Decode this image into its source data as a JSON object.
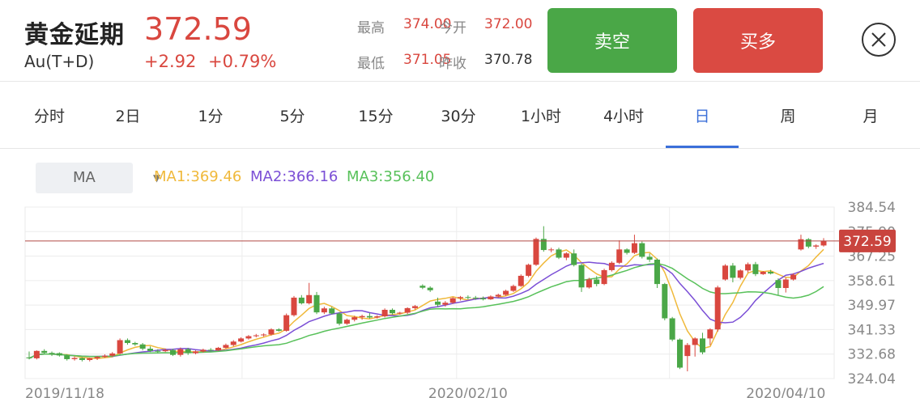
{
  "instrument": {
    "name": "黄金延期",
    "code": "Au(T+D)",
    "price": "372.59",
    "change": "+2.92",
    "change_pct": "+0.79%"
  },
  "quote": {
    "high_label": "最高",
    "high_value": "374.00",
    "open_label": "今开",
    "open_value": "372.00",
    "low_label": "最低",
    "low_value": "371.05",
    "prev_close_label": "昨收",
    "prev_close_value": "370.78"
  },
  "actions": {
    "sell_label": "卖空",
    "buy_label": "买多",
    "close_icon": "close-circle-icon"
  },
  "tabs": [
    {
      "label": "分时"
    },
    {
      "label": "2日"
    },
    {
      "label": "1分"
    },
    {
      "label": "5分"
    },
    {
      "label": "15分"
    },
    {
      "label": "30分"
    },
    {
      "label": "1小时"
    },
    {
      "label": "4小时"
    },
    {
      "label": "日",
      "active": true
    },
    {
      "label": "周"
    },
    {
      "label": "月"
    }
  ],
  "indicator": {
    "selected": "MA",
    "ma1": "MA1:369.46",
    "ma2": "MA2:366.16",
    "ma3": "MA3:356.40"
  },
  "colors": {
    "up": "#d9473f",
    "down": "#4aa747",
    "ma1": "#f0b93b",
    "ma2": "#7b4fd6",
    "ma3": "#58c15a",
    "active_tab": "#3b6fd9"
  },
  "chart_data": {
    "type": "candlestick",
    "y_ticks": [
      "384.54",
      "375.90",
      "367.25",
      "358.61",
      "349.97",
      "341.33",
      "332.68",
      "324.04"
    ],
    "ylim": [
      324.04,
      384.54
    ],
    "x_tick_labels": [
      {
        "label": "2019/11/18",
        "index": 0
      },
      {
        "label": "2020/02/10",
        "index": 58
      },
      {
        "label": "2020/04/10",
        "index": 100
      }
    ],
    "last_price_label": "372.59",
    "last_price": 372.59,
    "candles": [
      [
        331.5,
        333.6,
        330.8,
        331.2
      ],
      [
        331.2,
        334.0,
        330.8,
        333.8
      ],
      [
        333.8,
        334.4,
        332.6,
        333.1
      ],
      [
        333.1,
        333.6,
        332.0,
        332.5
      ],
      [
        333.0,
        333.3,
        331.8,
        332.2
      ],
      [
        332.2,
        332.6,
        330.4,
        330.9
      ],
      [
        330.9,
        331.8,
        330.4,
        331.3
      ],
      [
        331.3,
        331.6,
        330.1,
        330.6
      ],
      [
        330.6,
        331.4,
        330.1,
        331.2
      ],
      [
        331.2,
        332.0,
        330.6,
        331.7
      ],
      [
        331.7,
        332.6,
        331.4,
        332.1
      ],
      [
        332.1,
        333.4,
        331.8,
        332.9
      ],
      [
        332.9,
        338.2,
        332.6,
        337.6
      ],
      [
        337.6,
        338.2,
        336.0,
        336.6
      ],
      [
        336.6,
        337.0,
        335.6,
        336.1
      ],
      [
        336.1,
        336.6,
        334.0,
        334.6
      ],
      [
        334.6,
        335.4,
        333.4,
        333.8
      ],
      [
        333.8,
        334.4,
        333.0,
        333.7
      ],
      [
        333.7,
        334.6,
        333.4,
        334.1
      ],
      [
        334.1,
        334.6,
        332.0,
        332.4
      ],
      [
        332.4,
        335.0,
        331.8,
        334.4
      ],
      [
        334.4,
        334.9,
        332.4,
        333.0
      ],
      [
        333.0,
        334.0,
        332.6,
        333.6
      ],
      [
        333.6,
        334.6,
        333.2,
        334.2
      ],
      [
        334.2,
        334.8,
        333.6,
        334.0
      ],
      [
        334.0,
        335.2,
        333.8,
        334.9
      ],
      [
        334.9,
        336.4,
        334.6,
        335.9
      ],
      [
        335.9,
        337.6,
        335.4,
        337.1
      ],
      [
        337.1,
        338.6,
        336.8,
        338.2
      ],
      [
        338.2,
        339.4,
        337.8,
        339.0
      ],
      [
        339.0,
        339.8,
        338.6,
        339.3
      ],
      [
        339.3,
        340.0,
        338.8,
        339.6
      ],
      [
        339.6,
        341.8,
        339.2,
        341.4
      ],
      [
        341.4,
        341.8,
        340.6,
        340.9
      ],
      [
        340.9,
        347.0,
        340.6,
        346.4
      ],
      [
        346.4,
        353.2,
        345.9,
        352.6
      ],
      [
        352.6,
        353.5,
        350.2,
        350.6
      ],
      [
        350.6,
        357.8,
        350.2,
        353.5
      ],
      [
        353.5,
        354.6,
        346.8,
        347.4
      ],
      [
        347.4,
        349.4,
        346.8,
        348.8
      ],
      [
        348.8,
        349.4,
        346.6,
        347.0
      ],
      [
        347.0,
        347.5,
        342.8,
        343.4
      ],
      [
        343.4,
        345.2,
        343.0,
        344.8
      ],
      [
        344.8,
        346.2,
        344.2,
        345.7
      ],
      [
        345.7,
        346.6,
        344.8,
        346.1
      ],
      [
        346.1,
        347.2,
        345.2,
        345.6
      ],
      [
        345.6,
        346.4,
        345.2,
        346.0
      ],
      [
        346.0,
        348.8,
        345.6,
        348.3
      ],
      [
        348.3,
        348.8,
        346.6,
        347.1
      ],
      [
        347.1,
        347.6,
        346.6,
        347.3
      ],
      [
        347.3,
        349.2,
        346.8,
        348.9
      ],
      [
        348.9,
        350.0,
        348.4,
        349.6
      ],
      [
        356.8,
        357.3,
        355.6,
        356.1
      ],
      [
        356.1,
        356.6,
        354.6,
        355.2
      ],
      [
        351.2,
        352.6,
        349.4,
        350.1
      ],
      [
        350.1,
        351.4,
        349.4,
        350.8
      ],
      [
        350.8,
        352.8,
        350.4,
        352.4
      ],
      [
        352.4,
        353.2,
        351.6,
        352.8
      ],
      [
        352.8,
        353.4,
        352.0,
        352.6
      ],
      [
        352.6,
        353.2,
        351.8,
        352.4
      ],
      [
        352.4,
        353.0,
        351.6,
        352.0
      ],
      [
        352.0,
        353.4,
        351.8,
        353.0
      ],
      [
        353.0,
        354.0,
        352.6,
        353.6
      ],
      [
        353.6,
        355.4,
        353.2,
        355.0
      ],
      [
        355.0,
        357.2,
        354.6,
        356.7
      ],
      [
        356.7,
        360.8,
        356.4,
        360.3
      ],
      [
        360.3,
        364.6,
        359.8,
        364.2
      ],
      [
        364.2,
        373.8,
        363.8,
        373.3
      ],
      [
        373.3,
        377.8,
        368.8,
        369.4
      ],
      [
        369.4,
        370.2,
        368.6,
        369.6
      ],
      [
        369.6,
        370.2,
        366.2,
        366.7
      ],
      [
        366.7,
        368.6,
        365.8,
        368.2
      ],
      [
        368.2,
        369.6,
        363.6,
        364.1
      ],
      [
        364.1,
        364.6,
        354.6,
        356.2
      ],
      [
        356.2,
        359.6,
        355.8,
        359.0
      ],
      [
        359.0,
        360.2,
        356.6,
        357.4
      ],
      [
        357.4,
        362.8,
        357.0,
        362.3
      ],
      [
        362.3,
        365.4,
        361.8,
        364.9
      ],
      [
        364.9,
        372.8,
        364.4,
        369.6
      ],
      [
        369.6,
        370.0,
        367.8,
        368.4
      ],
      [
        368.4,
        374.8,
        368.0,
        371.8
      ],
      [
        371.8,
        372.4,
        366.4,
        367.0
      ],
      [
        367.0,
        368.2,
        365.2,
        366.0
      ],
      [
        366.0,
        366.4,
        356.0,
        357.4
      ],
      [
        357.4,
        357.8,
        344.6,
        345.3
      ],
      [
        345.3,
        345.8,
        337.2,
        337.8
      ],
      [
        337.8,
        338.2,
        327.4,
        327.9
      ],
      [
        332.0,
        336.6,
        326.6,
        335.9
      ],
      [
        335.9,
        338.6,
        331.8,
        338.2
      ],
      [
        338.2,
        340.2,
        332.6,
        333.3
      ],
      [
        338.2,
        341.8,
        335.8,
        341.4
      ],
      [
        341.4,
        356.8,
        340.6,
        356.2
      ],
      [
        359.0,
        364.4,
        358.6,
        363.9
      ],
      [
        363.9,
        364.8,
        358.0,
        359.6
      ],
      [
        359.6,
        362.6,
        359.0,
        362.2
      ],
      [
        362.2,
        365.0,
        361.4,
        364.4
      ],
      [
        364.4,
        365.2,
        360.2,
        360.9
      ],
      [
        360.9,
        362.0,
        360.6,
        361.7
      ],
      [
        361.7,
        362.4,
        360.8,
        361.1
      ],
      [
        358.8,
        359.4,
        353.6,
        356.0
      ],
      [
        356.0,
        359.6,
        354.4,
        359.0
      ],
      [
        359.0,
        361.2,
        358.6,
        360.7
      ],
      [
        369.6,
        374.8,
        369.2,
        373.2
      ],
      [
        373.2,
        373.6,
        370.0,
        370.6
      ],
      [
        370.6,
        371.4,
        369.8,
        371.0
      ],
      [
        371.0,
        373.6,
        370.6,
        372.6
      ]
    ]
  }
}
